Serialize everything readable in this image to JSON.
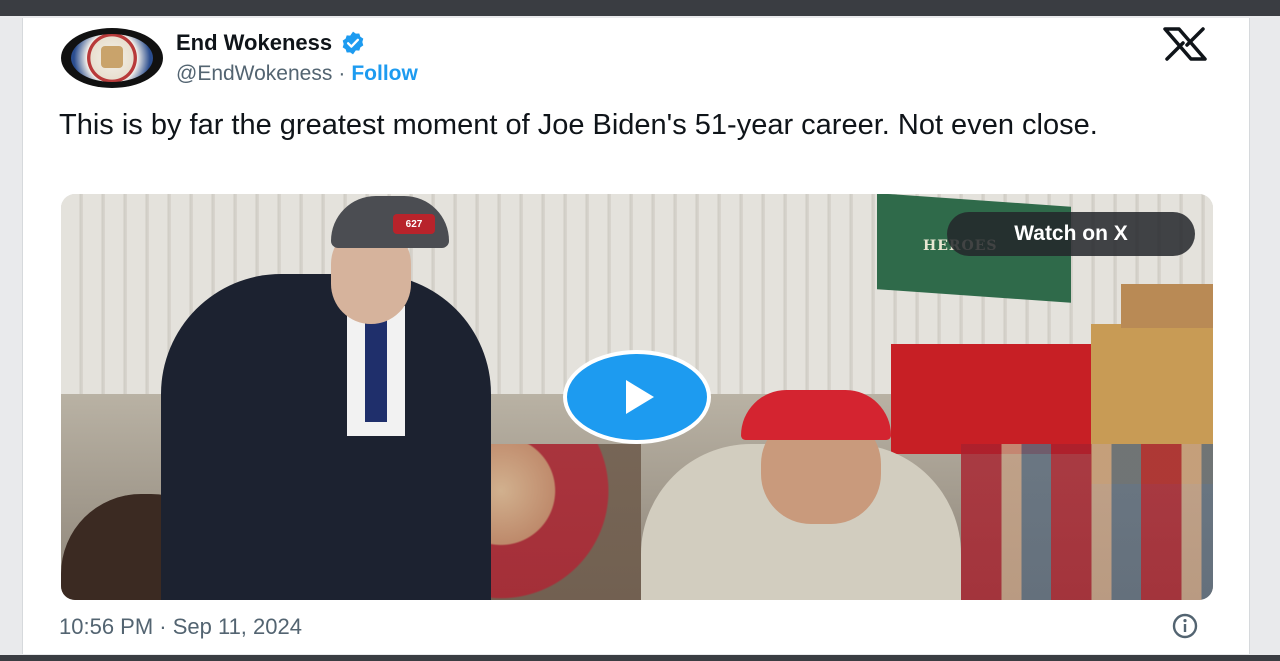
{
  "author": {
    "display_name": "End Wokeness",
    "handle": "@EndWokeness",
    "separator": "·",
    "follow_label": "Follow",
    "verified_color": "#1d9bf0"
  },
  "tweet": {
    "text": "This is by far the greatest moment of Joe Biden's 51-year career. Not even close.",
    "timestamp": "10:56 PM · Sep 11, 2024"
  },
  "media": {
    "watch_label": "Watch on X",
    "cap_badge": "627",
    "banner_text": "HEROES"
  },
  "icons": {
    "logo": "x-logo-icon",
    "verified": "verified-badge-icon",
    "play": "play-icon",
    "info": "info-icon"
  },
  "colors": {
    "accent": "#1d9bf0",
    "text_primary": "#0f1419",
    "text_secondary": "#536471"
  }
}
